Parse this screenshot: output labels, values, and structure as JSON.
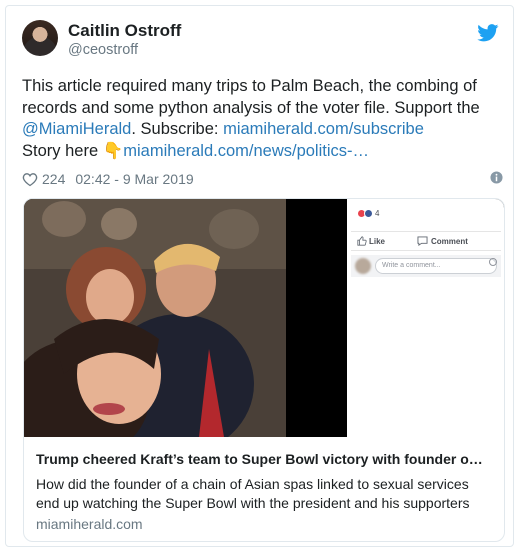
{
  "author": {
    "name": "Caitlin Ostroff",
    "handle": "@ceostroff"
  },
  "tweet": {
    "text_part1": "This article required many trips to Palm Beach, the combing of records and some python analysis of the voter file. Support the ",
    "mention": "@MiamiHerald",
    "text_part2": ". Subscribe: ",
    "link1": "miamiherald.com/subscribe",
    "text_part3": "Story here ",
    "emoji": "👇",
    "link2": "miamiherald.com/news/politics-…"
  },
  "meta": {
    "likes": "224",
    "timestamp": "02:42 - 9 Mar 2019"
  },
  "card": {
    "title": "Trump cheered Kraft’s team to Super Bowl victory with founder o…",
    "description": "How did the founder of a chain of Asian spas linked to sexual services end up watching the Super Bowl with the president and his supporters",
    "domain": "miamiherald.com",
    "fb_reaction_count": "4",
    "fb_like_label": "Like",
    "fb_comment_label": "Comment",
    "fb_input_placeholder": "Write a comment..."
  },
  "icons": {
    "bird": "twitter-bird-icon",
    "heart": "heart-icon",
    "info": "info-icon",
    "pointing": "backhand-index-pointing-down-icon"
  },
  "colors": {
    "link": "#2b7bb9",
    "twitter_blue": "#1da1f2",
    "muted": "#697882",
    "border": "#e1e8ed"
  }
}
